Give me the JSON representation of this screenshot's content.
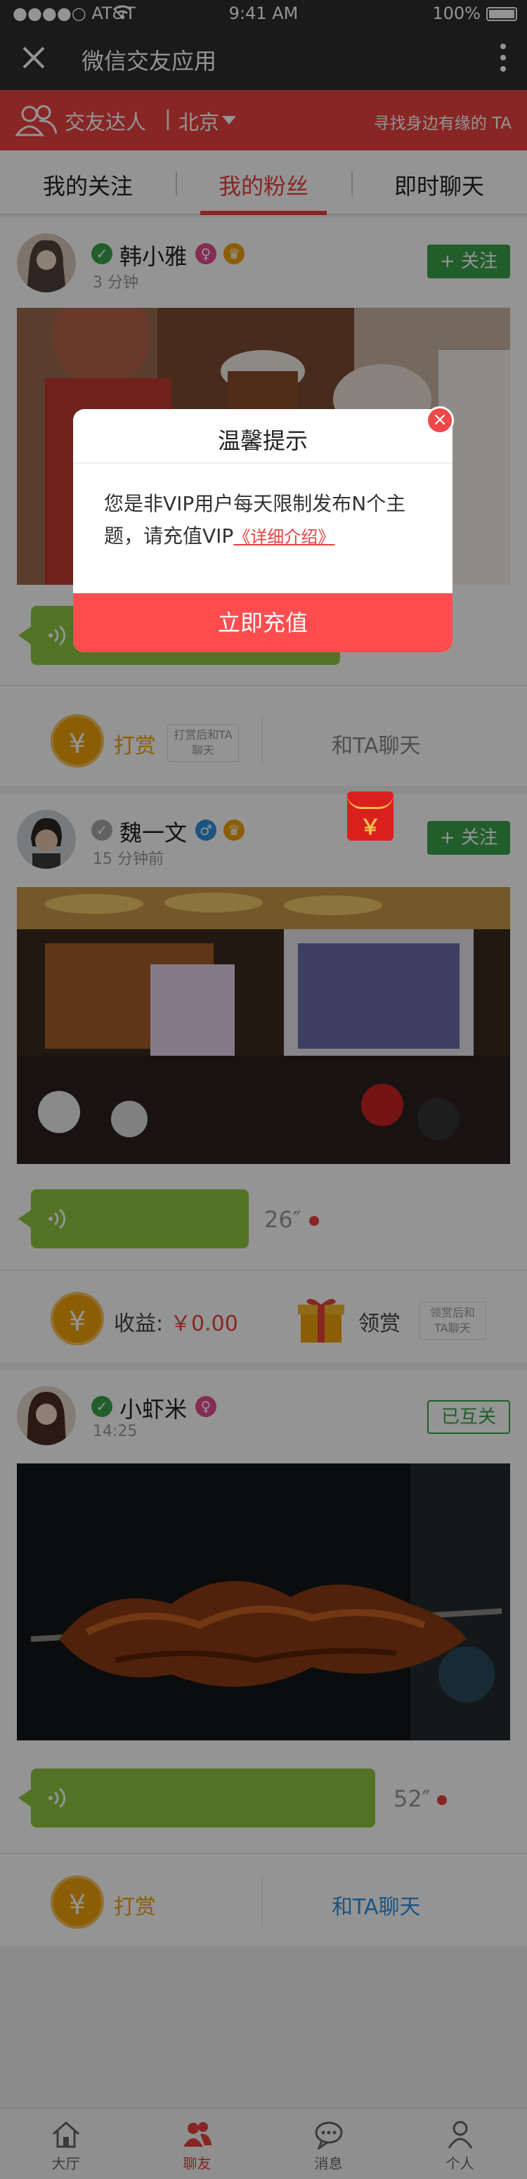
{
  "status_bar": {
    "carrier": "●●●●○ AT&T",
    "wifi_icon": "wifi-icon",
    "time": "9:41 AM",
    "battery": "100%"
  },
  "title_bar": {
    "close_icon": "close-icon",
    "title": "微信交友应用",
    "more_icon": "more-vertical-icon"
  },
  "banner": {
    "label": "交友达人",
    "separator": "|",
    "city": "北京",
    "slogan": "寻找身边有缘的 TA"
  },
  "tabs": [
    {
      "label": "我的关注",
      "active": false
    },
    {
      "label": "我的粉丝",
      "active": true
    },
    {
      "label": "即时聊天",
      "active": false
    }
  ],
  "posts": [
    {
      "name": "韩小雅",
      "time": "3 分钟",
      "gender": "female",
      "follow_label": "+ 关注",
      "reward_label": "打赏",
      "reward_hint": "打赏后和TA聊天",
      "chat_label": "和TA聊天"
    },
    {
      "name": "魏一文",
      "time": "15 分钟前",
      "gender": "male",
      "follow_label": "+ 关注",
      "duration": "26″",
      "income_label": "收益:",
      "income_value": "￥0.00",
      "claim_label": "领赏",
      "claim_hint": "领赏后和TA聊天",
      "redpacket_symbol": "￥"
    },
    {
      "name": "小虾米",
      "time": "14:25",
      "gender": "female",
      "follow_label": "已互关",
      "duration": "52″",
      "reward_label": "打赏",
      "chat_label": "和TA聊天"
    }
  ],
  "modal": {
    "title": "温馨提示",
    "body": "您是非VIP用户每天限制发布N个主题，请充值VIP",
    "link": "《详细介绍》",
    "button": "立即充值",
    "close_symbol": "×"
  },
  "bottom_nav": [
    {
      "label": "大厅",
      "icon": "home-icon",
      "active": false
    },
    {
      "label": "聊友",
      "icon": "friends-icon",
      "active": true
    },
    {
      "label": "消息",
      "icon": "message-icon",
      "active": false
    },
    {
      "label": "个人",
      "icon": "person-icon",
      "active": false
    }
  ],
  "colors": {
    "brand_red": "#e8423f",
    "follow_green": "#3aa34a",
    "voice_green": "#8ec63f",
    "coin_orange": "#f0a20b"
  }
}
